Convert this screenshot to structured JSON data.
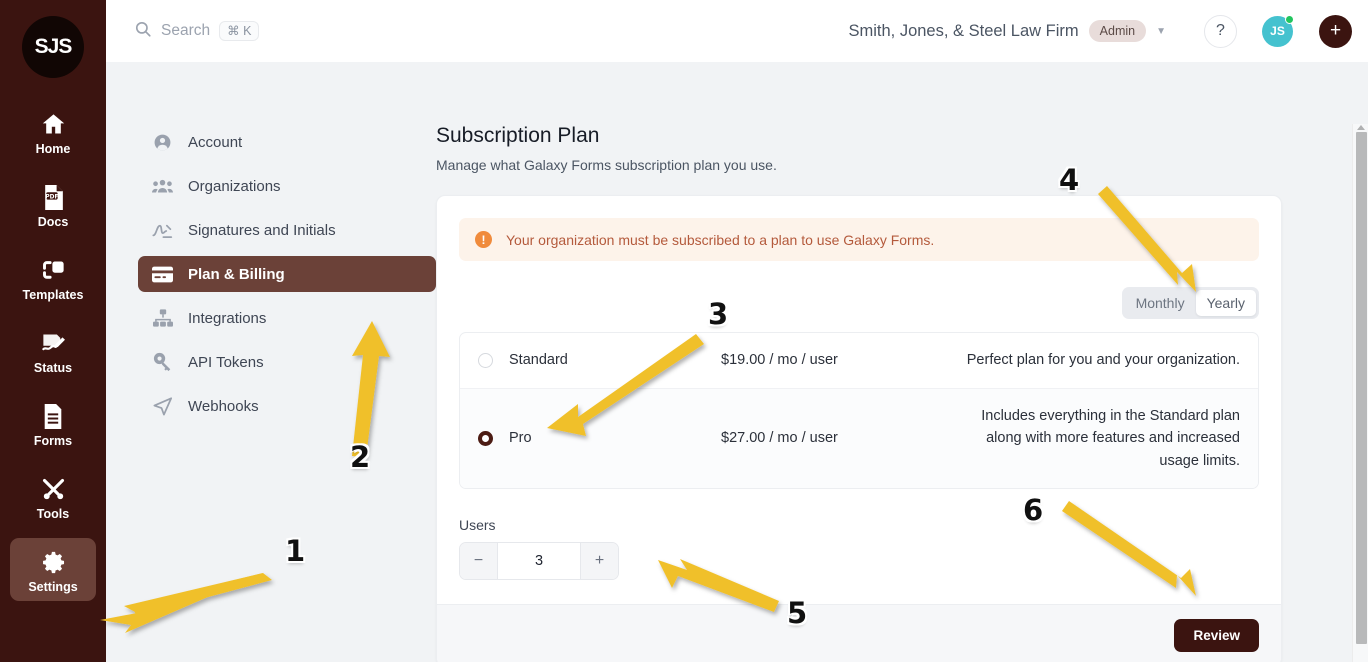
{
  "rail": {
    "logo_text": "SJS",
    "items": [
      {
        "label": "Home",
        "icon": "home-icon",
        "active": false
      },
      {
        "label": "Docs",
        "icon": "pdf-document-icon",
        "active": false
      },
      {
        "label": "Templates",
        "icon": "templates-copy-icon",
        "active": false
      },
      {
        "label": "Status",
        "icon": "signature-status-icon",
        "active": false
      },
      {
        "label": "Forms",
        "icon": "form-lines-icon",
        "active": false
      },
      {
        "label": "Tools",
        "icon": "tools-wrench-screwdriver-icon",
        "active": false
      },
      {
        "label": "Settings",
        "icon": "gear-icon",
        "active": true
      }
    ]
  },
  "topbar": {
    "search_placeholder": "Search",
    "search_shortcut": "⌘ K",
    "org_name": "Smith, Jones, & Steel Law Firm",
    "role_badge": "Admin",
    "help_label": "?",
    "avatar_initials": "JS",
    "add_label": "+"
  },
  "settings_nav": {
    "items": [
      {
        "label": "Account",
        "icon": "user-circle-icon",
        "active": false
      },
      {
        "label": "Organizations",
        "icon": "people-group-icon",
        "active": false
      },
      {
        "label": "Signatures and Initials",
        "icon": "signature-icon",
        "active": false
      },
      {
        "label": "Plan & Billing",
        "icon": "credit-card-icon",
        "active": true
      },
      {
        "label": "Integrations",
        "icon": "sitemap-icon",
        "active": false
      },
      {
        "label": "API Tokens",
        "icon": "key-icon",
        "active": false
      },
      {
        "label": "Webhooks",
        "icon": "share-nodes-icon",
        "active": false
      }
    ]
  },
  "main": {
    "title": "Subscription Plan",
    "subtitle": "Manage what Galaxy Forms subscription plan you use.",
    "alert": {
      "icon": "exclamation-circle-icon",
      "text": "Your organization must be subscribed to a plan to use Galaxy Forms."
    },
    "billing_cycle": {
      "options": [
        "Monthly",
        "Yearly"
      ],
      "selected": "Yearly"
    },
    "plans": [
      {
        "name": "Standard",
        "price": "$19.00 / mo / user",
        "description": "Perfect plan for you and your organization.",
        "selected": false
      },
      {
        "name": "Pro",
        "price": "$27.00 / mo / user",
        "description": "Includes everything in the Standard plan along with more features and increased usage limits.",
        "selected": true
      }
    ],
    "users": {
      "label": "Users",
      "value": "3",
      "decrement_label": "−",
      "increment_label": "+"
    },
    "footer": {
      "review_label": "Review"
    }
  },
  "annotations": {
    "accent_color": "#f0c02c",
    "markers": [
      {
        "number": "1",
        "target": "settings-rail-item"
      },
      {
        "number": "2",
        "target": "plan-and-billing-nav-item"
      },
      {
        "number": "3",
        "target": "pro-plan-radio"
      },
      {
        "number": "4",
        "target": "billing-cycle-toggle"
      },
      {
        "number": "5",
        "target": "users-increment-button"
      },
      {
        "number": "6",
        "target": "review-button"
      }
    ]
  }
}
